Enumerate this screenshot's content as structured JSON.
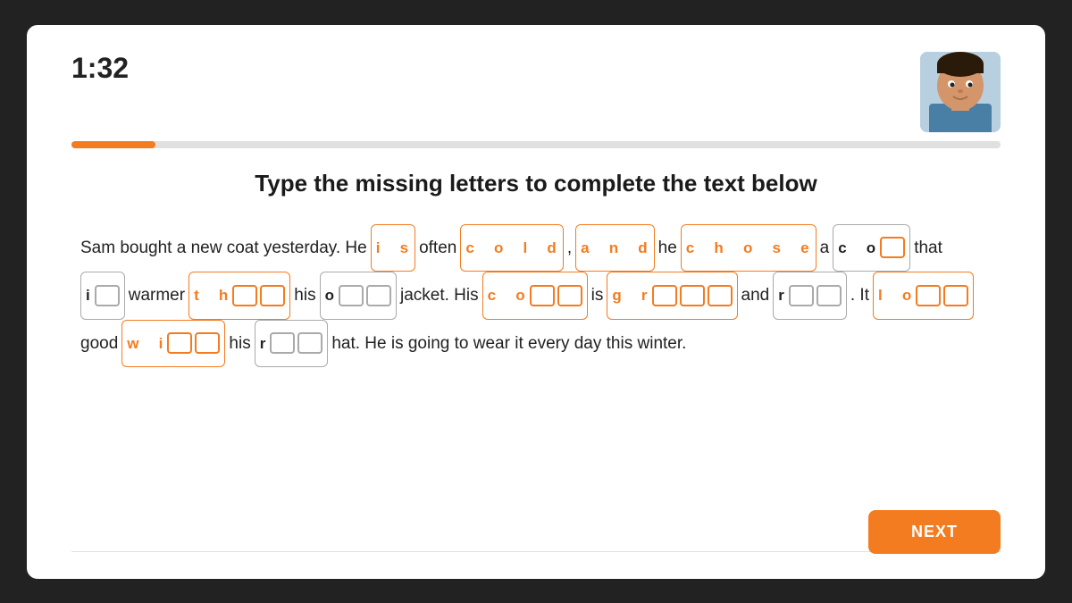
{
  "timer": "1:32",
  "progress": {
    "fill_percent": 9,
    "color": "#f47c20"
  },
  "instruction": "Type the missing letters to complete the text below",
  "next_button": "NEXT",
  "lines": [
    {
      "id": "line1",
      "segments": [
        {
          "type": "text",
          "value": "Sam bought a new coat yesterday. He"
        },
        {
          "type": "pill",
          "style": "orange",
          "letters": [
            "i",
            "s"
          ]
        },
        {
          "type": "text",
          "value": "often"
        },
        {
          "type": "pill",
          "style": "orange",
          "letters": [
            "c",
            "o",
            "l",
            "d"
          ]
        },
        {
          "type": "text",
          "value": ","
        },
        {
          "type": "pill",
          "style": "orange",
          "letters": [
            "a",
            "n",
            "d"
          ]
        },
        {
          "type": "text",
          "value": "he"
        },
        {
          "type": "pill",
          "style": "orange",
          "letters": [
            "c",
            "h",
            "o",
            "s",
            "e"
          ]
        },
        {
          "type": "text",
          "value": "a"
        },
        {
          "type": "pill-blank",
          "style": "orange-border",
          "letters": [
            "c",
            "o"
          ],
          "blank_count": 1
        },
        {
          "type": "text",
          "value": "that"
        }
      ]
    },
    {
      "id": "line2",
      "segments": [
        {
          "type": "pill-blank",
          "style": "gray",
          "letters": [
            "i"
          ],
          "blank_count": 1
        },
        {
          "type": "text",
          "value": "warmer"
        },
        {
          "type": "pill-blank",
          "style": "orange",
          "letters": [
            "t",
            "h"
          ],
          "blank_count": 2
        },
        {
          "type": "text",
          "value": "his"
        },
        {
          "type": "pill-blank",
          "style": "gray",
          "letters": [
            "o"
          ],
          "blank_count": 2
        },
        {
          "type": "text",
          "value": "jacket. His"
        },
        {
          "type": "pill-blank",
          "style": "orange",
          "letters": [
            "c",
            "o"
          ],
          "blank_count": 2
        },
        {
          "type": "text",
          "value": "is"
        },
        {
          "type": "pill-blank",
          "style": "orange",
          "letters": [
            "g",
            "r"
          ],
          "blank_count": 3
        },
        {
          "type": "text",
          "value": "and"
        },
        {
          "type": "pill-blank",
          "style": "gray",
          "letters": [
            "r"
          ],
          "blank_count": 2
        },
        {
          "type": "text",
          "value": ". It"
        },
        {
          "type": "pill-blank",
          "style": "orange",
          "letters": [
            "l",
            "o"
          ],
          "blank_count": 2
        }
      ]
    },
    {
      "id": "line3",
      "segments": [
        {
          "type": "text",
          "value": "good"
        },
        {
          "type": "pill-blank",
          "style": "orange",
          "letters": [
            "w",
            "i"
          ],
          "blank_count": 2
        },
        {
          "type": "text",
          "value": "his"
        },
        {
          "type": "pill-blank",
          "style": "gray",
          "letters": [
            "r"
          ],
          "blank_count": 2
        },
        {
          "type": "text",
          "value": "hat. He is going to wear it every day this winter."
        }
      ]
    }
  ]
}
